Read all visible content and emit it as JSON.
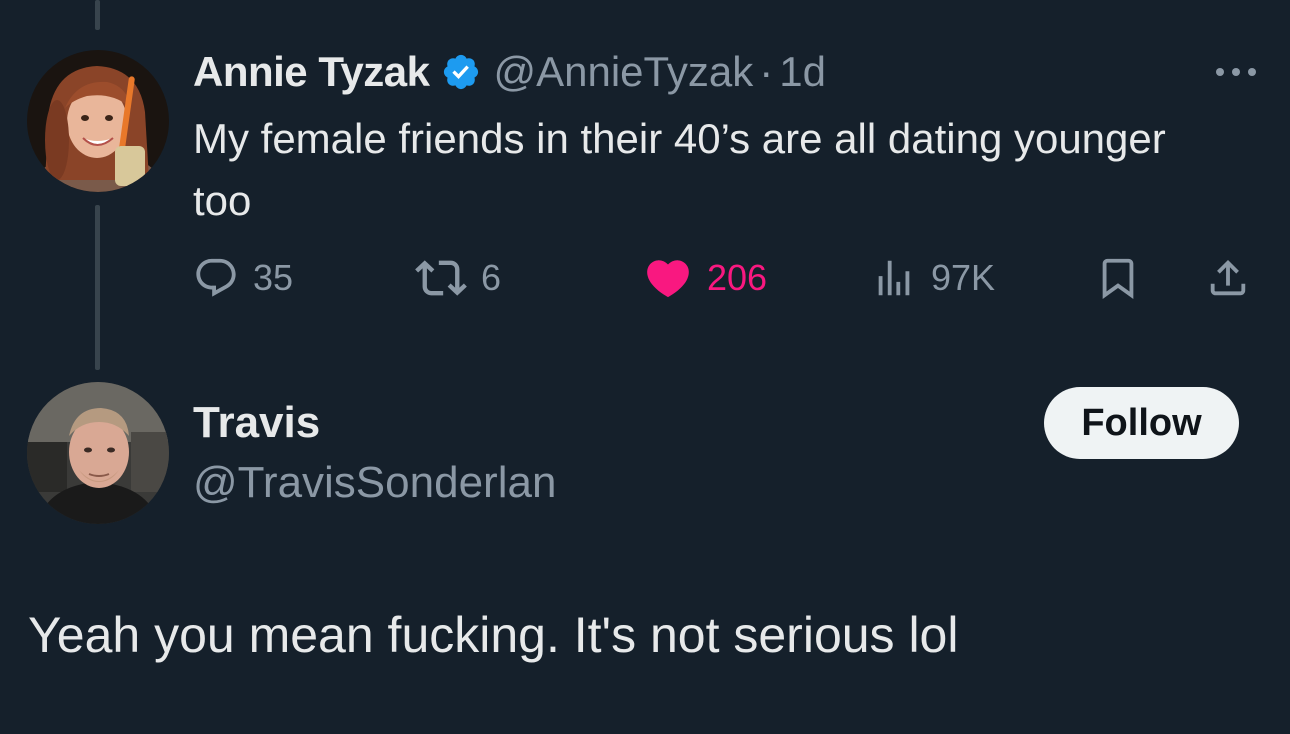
{
  "colors": {
    "background": "#15202b",
    "primary_text": "#e7e9ea",
    "secondary_text": "#8b98a5",
    "like_color": "#f91880",
    "verified_color": "#1d9bf0",
    "follow_button_bg": "#eff3f4"
  },
  "tweet": {
    "author_name": "Annie Tyzak",
    "verified": true,
    "handle": "@AnnieTyzak",
    "separator": "·",
    "time": "1d",
    "text": "My female friends in their 40’s are all dating younger too",
    "more_icon": "more-horizontal-icon",
    "actions": {
      "replies": "35",
      "retweets": "6",
      "likes": "206",
      "views": "97K"
    },
    "liked": true
  },
  "reply": {
    "author_name": "Travis",
    "handle": "@TravisSonderlan",
    "follow_label": "Follow",
    "text": "Yeah you mean fucking. It's not serious lol"
  }
}
